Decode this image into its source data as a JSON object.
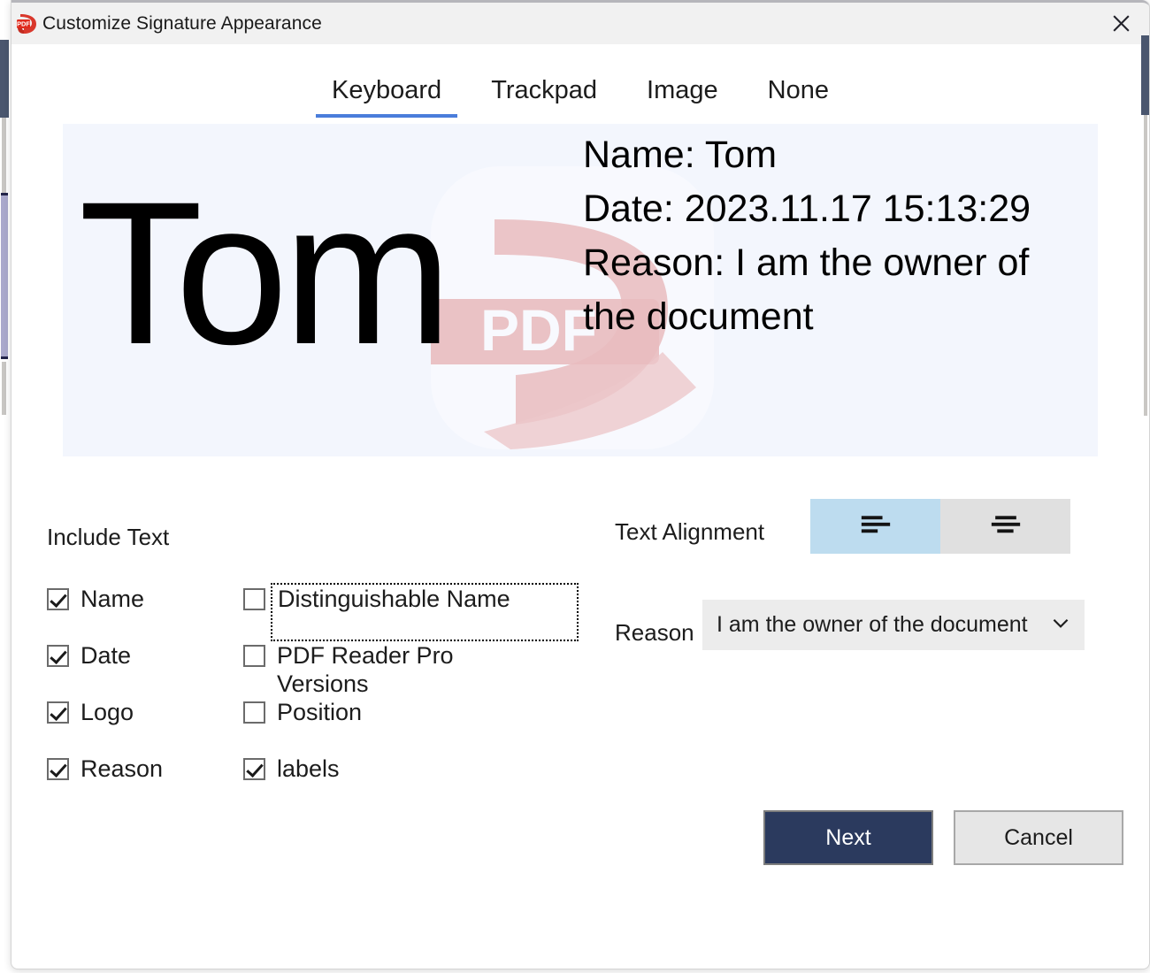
{
  "window": {
    "title": "Customize Signature Appearance",
    "app_icon": "pdf-document-icon",
    "close_icon": "close-icon"
  },
  "tabs": [
    {
      "label": "Keyboard",
      "active": true
    },
    {
      "label": "Trackpad",
      "active": false
    },
    {
      "label": "Image",
      "active": false
    },
    {
      "label": "None",
      "active": false
    }
  ],
  "preview": {
    "signature_name": "Tom",
    "logo_icon": "pdf-reader-pro-watermark-logo",
    "lines": [
      "Name: Tom",
      "Date: 2023.11.17 15:13:29",
      "Reason: I am the owner of the document"
    ]
  },
  "include_text": {
    "heading": "Include Text",
    "column_left": [
      {
        "label": "Name",
        "checked": true
      },
      {
        "label": "Date",
        "checked": true
      },
      {
        "label": "Logo",
        "checked": true
      },
      {
        "label": "Reason",
        "checked": true
      }
    ],
    "column_right": [
      {
        "label": "Distinguishable Name",
        "checked": false,
        "focused": true
      },
      {
        "label": "PDF Reader Pro\nVersions",
        "checked": false,
        "focused": false
      },
      {
        "label": "Position",
        "checked": false,
        "focused": false
      },
      {
        "label": "labels",
        "checked": true,
        "focused": false
      }
    ]
  },
  "text_alignment": {
    "label": "Text Alignment",
    "options": [
      {
        "icon": "align-left-icon",
        "selected": true
      },
      {
        "icon": "align-center-icon",
        "selected": false
      }
    ]
  },
  "reason": {
    "label": "Reason",
    "value": "I am the owner of the document",
    "chevron_icon": "chevron-down-icon"
  },
  "actions": {
    "next_label": "Next",
    "cancel_label": "Cancel"
  },
  "colors": {
    "accent_tab_underline": "#4a7ddb",
    "primary_button": "#2b3a5e",
    "alignment_selected": "#bddcef",
    "preview_background": "#f3f6fd",
    "logo_red": "#d9382c"
  }
}
